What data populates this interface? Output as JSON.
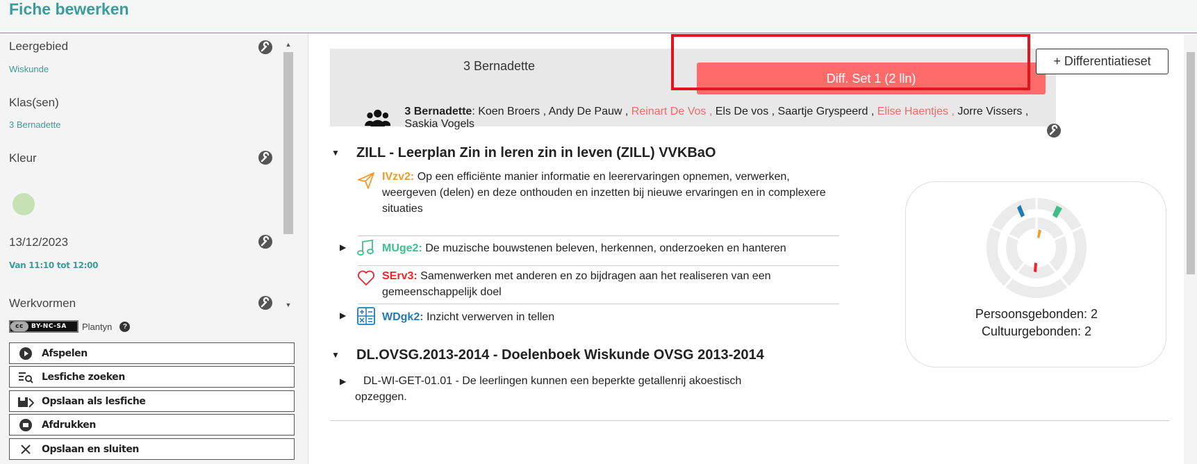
{
  "header": {
    "title": "Fiche bewerken"
  },
  "sidebar": {
    "leergebied": {
      "label": "Leergebied",
      "value": "Wiskunde"
    },
    "klassen": {
      "label": "Klas(sen)",
      "value": "3 Bernadette"
    },
    "kleur": {
      "label": "Kleur",
      "color": "#c6e2b5"
    },
    "datum": {
      "label": "13/12/2023",
      "value": "Van 11:10 tot 12:00"
    },
    "werkvormen": {
      "label": "Werkvormen"
    },
    "license": {
      "badge": "BY-NC-SA",
      "cc": "cc",
      "source": "Plantyn",
      "help": "?"
    },
    "buttons": [
      {
        "label": "Afspelen",
        "icon": "play-icon"
      },
      {
        "label": "Lesfiche zoeken",
        "icon": "search-list-icon"
      },
      {
        "label": "Opslaan als lesfiche",
        "icon": "save-icon"
      },
      {
        "label": "Afdrukken",
        "icon": "print-icon"
      },
      {
        "label": "Opslaan en sluiten",
        "icon": "close-icon"
      }
    ]
  },
  "main": {
    "tabs": {
      "active": "3 Bernadette",
      "diff": "Diff. Set 1 (2 lln)",
      "add_button": "+ Differentiatieset"
    },
    "class_members": {
      "class_name": "3 Bernadette",
      "students": [
        {
          "name": "Koen Broers ,",
          "highlighted": false
        },
        {
          "name": "Andy De Pauw ,",
          "highlighted": false
        },
        {
          "name": "Reinart De Vos ,",
          "highlighted": true
        },
        {
          "name": "Els De vos ,",
          "highlighted": false
        },
        {
          "name": "Saartje Gryspeerd ,",
          "highlighted": false
        },
        {
          "name": "Elise Haentjes ,",
          "highlighted": true
        },
        {
          "name": "Jorre Vissers ,",
          "highlighted": false
        },
        {
          "name": "Saskia Vogels",
          "highlighted": false
        }
      ]
    },
    "sections": [
      {
        "title": "ZILL - Leerplan Zin in leren zin in leven (ZILL) VVKBaO",
        "goals": [
          {
            "code": "IVzv2:",
            "color": "#f39a2b",
            "icon": "paper-plane-icon",
            "text": "Op een efficiënte manier informatie en leerervaringen opnemen, verwerken, weergeven (delen) en deze onthouden en inzetten bij nieuwe ervaringen en in complexere situaties"
          },
          {
            "code": "MUge2:",
            "color": "#3dbf8a",
            "icon": "music-note-icon",
            "text": "De muzische bouwstenen beleven, herkennen, onderzoeken en hanteren"
          },
          {
            "code": "SErv3:",
            "color": "#e8262c",
            "icon": "heart-icon",
            "text": "Samenwerken met anderen en zo bijdragen aan het realiseren van een gemeenschappelijk doel"
          },
          {
            "code": "WDgk2:",
            "color": "#1f7bb6",
            "icon": "calculator-icon",
            "text": "Inzicht verwerven in tellen"
          }
        ],
        "chart": {
          "persoonsgebonden": "Persoonsgebonden: 2",
          "cultuurgebonden": "Cultuurgebonden: 2"
        }
      },
      {
        "title": "DL.OVSG.2013-2014 - Doelenboek Wiskunde OVSG 2013-2014",
        "items": [
          {
            "text": "DL-WI-GET-01.01 - De leerlingen kunnen een beperkte getallenrij akoestisch opzeggen."
          }
        ]
      }
    ]
  }
}
